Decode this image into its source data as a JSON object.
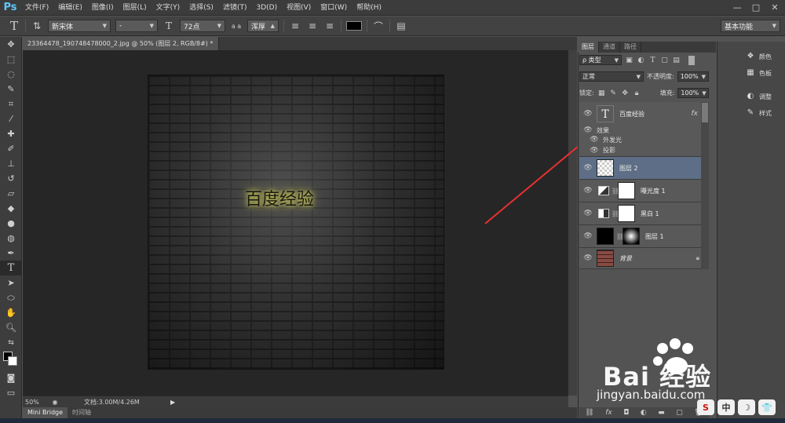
{
  "app": {
    "logo": "Ps"
  },
  "menu": [
    "文件(F)",
    "编辑(E)",
    "图像(I)",
    "图层(L)",
    "文字(Y)",
    "选择(S)",
    "滤镜(T)",
    "3D(D)",
    "视图(V)",
    "窗口(W)",
    "帮助(H)"
  ],
  "window_buttons": [
    "—",
    "□",
    "✕"
  ],
  "options": {
    "font_family": "新宋体",
    "font_style": "-",
    "font_size": "72点",
    "anti_alias": "浑厚",
    "workspace": "基本功能",
    "aa_label": "a a",
    "color": "#000000"
  },
  "document": {
    "tab_title": "23364478_190748478000_2.jpg @ 50% (图层 2, RGB/8#) *",
    "image_text": "百度经验"
  },
  "status": {
    "zoom": "50%",
    "doc_info": "文档:3.00M/4.26M"
  },
  "bottom_tabs": [
    "Mini Bridge",
    "时间轴"
  ],
  "panel_tabs": [
    "图层",
    "通道",
    "路径"
  ],
  "layers_panel": {
    "filter_kind": "类型",
    "blend_mode": "正常",
    "opacity_label": "不透明度:",
    "opacity_value": "100%",
    "lock_label": "锁定:",
    "fill_label": "填充:",
    "fill_value": "100%"
  },
  "layers": [
    {
      "name": "百度经验",
      "type": "text",
      "fx": "fx"
    },
    {
      "name": "图层 2",
      "type": "transparent",
      "selected": true
    },
    {
      "name": "曝光度 1",
      "type": "adjustment"
    },
    {
      "name": "黑白 1",
      "type": "adjustment"
    },
    {
      "name": "图层 1",
      "type": "masked"
    },
    {
      "name": "背景",
      "type": "background"
    }
  ],
  "effects": {
    "label": "效果",
    "items": [
      "外发光",
      "投影"
    ]
  },
  "right_panels": [
    "颜色",
    "色板",
    "调整",
    "样式"
  ],
  "watermark": {
    "brand": "Bai 经验",
    "url": "jingyan.baidu.com"
  },
  "tray": [
    "S",
    "中",
    "☽",
    "👕"
  ]
}
